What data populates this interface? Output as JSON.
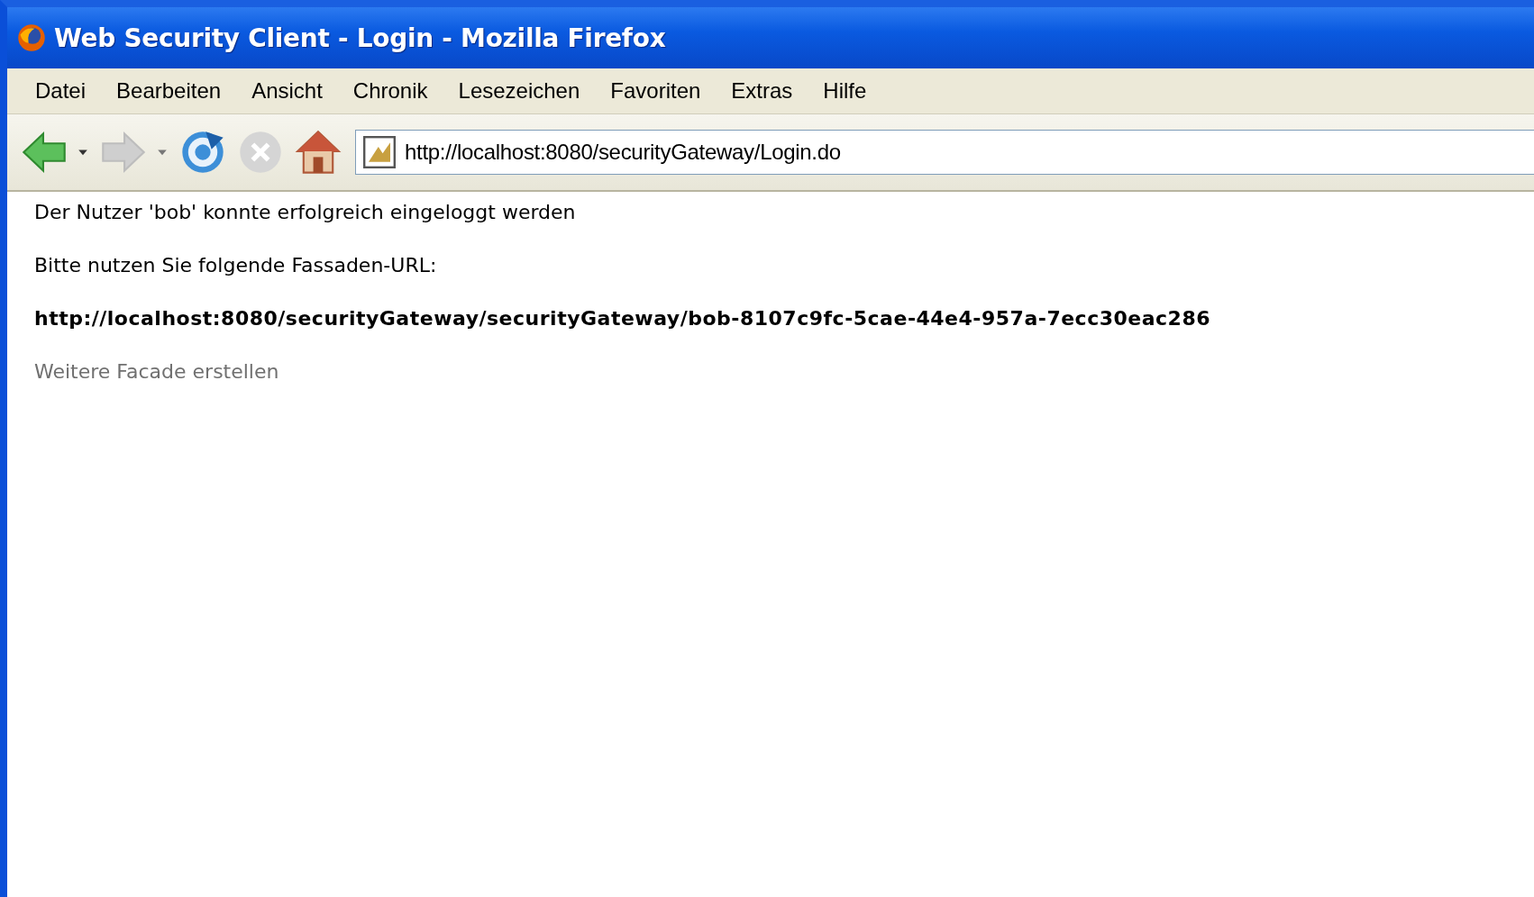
{
  "window": {
    "title": "Web Security Client - Login - Mozilla Firefox"
  },
  "menu": [
    "Datei",
    "Bearbeiten",
    "Ansicht",
    "Chronik",
    "Lesezeichen",
    "Favoriten",
    "Extras",
    "Hilfe"
  ],
  "toolbar": {
    "back_disabled": false,
    "forward_disabled": true,
    "stop_disabled": true
  },
  "address": {
    "value": "http://localhost:8080/securityGateway/Login.do"
  },
  "content": [
    {
      "kind": "text",
      "text": "Der Nutzer 'bob' konnte erfolgreich eingeloggt werden"
    },
    {
      "kind": "text",
      "text": "Bitte nutzen Sie folgende Fassaden-URL:"
    },
    {
      "kind": "strong",
      "text": "http://localhost:8080/securityGateway/securityGateway/bob-8107c9fc-5cae-44e4-957a-7ecc30eac286"
    },
    {
      "kind": "link",
      "text": "Weitere Facade erstellen"
    }
  ]
}
